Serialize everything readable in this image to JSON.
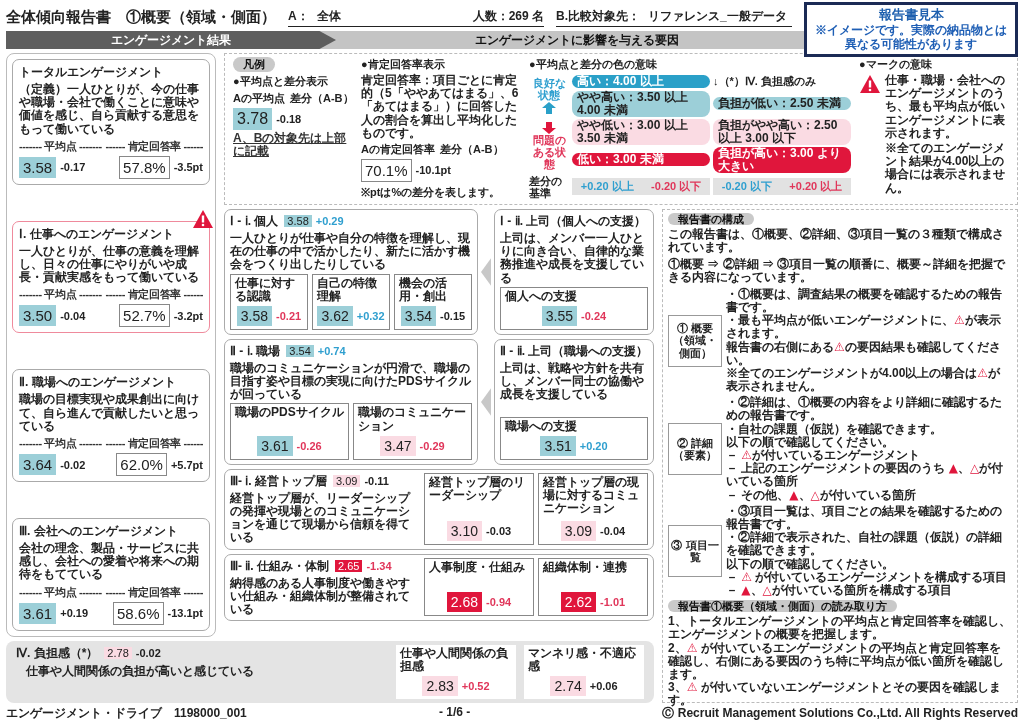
{
  "header": {
    "title": "全体傾向報告書　①概要（領域・側面）",
    "group_a": {
      "label": "A：",
      "value": "全体",
      "count": "人数：269 名"
    },
    "group_b": {
      "label": "B.比較対象先：",
      "value": "リファレンス_一般データ"
    }
  },
  "sample_notice": {
    "title": "報告書見本",
    "text": "※イメージです。実際の納品物とは異なる可能性があります"
  },
  "banner": {
    "results": "エンゲージメント結果",
    "factors": "エンゲージメントに影響を与える要因"
  },
  "total": {
    "title": "トータルエンゲージメント",
    "text": "（定義）一人ひとりが、今の仕事や職場・会社で働くことに意味や価値を感じ、自ら貢献する意思をもって働いている",
    "avg_label": "------- 平均点 -------",
    "rate_label": "------ 肯定回答率 ------",
    "score": {
      "value": "3.58",
      "color": "#9ccfd8",
      "diff": {
        "text": "-0.17",
        "color": "#222222"
      }
    },
    "rate": {
      "value": "57.8%",
      "diff": "-3.5pt"
    }
  },
  "areas": [
    {
      "title": "Ⅰ. 仕事へのエンゲージメント",
      "text": "一人ひとりが、仕事の意義を理解し、日々の仕事にやりがいや成長・貢献実感をもって働いている",
      "warning": true,
      "avg_label": "------- 平均点 -------",
      "rate_label": "------ 肯定回答率 ------",
      "score": {
        "value": "3.50",
        "color": "#9ccfd8",
        "diff": {
          "text": "-0.04",
          "color": "#222222"
        }
      },
      "rate": {
        "value": "52.7%",
        "diff": "-3.2pt"
      }
    },
    {
      "title": "Ⅱ. 職場へのエンゲージメント",
      "text": "職場の目標実現や成果創出に向けて、自ら進んで貢献したいと思っている",
      "warning": false,
      "avg_label": "------- 平均点 -------",
      "rate_label": "------ 肯定回答率 ------",
      "score": {
        "value": "3.64",
        "color": "#9ccfd8",
        "diff": {
          "text": "-0.02",
          "color": "#222222"
        }
      },
      "rate": {
        "value": "62.0%",
        "diff": "+5.7pt"
      }
    },
    {
      "title": "Ⅲ. 会社へのエンゲージメント",
      "text": "会社の理念、製品・サービスに共感し、会社への愛着や将来への期待をもてている",
      "warning": false,
      "avg_label": "------- 平均点 -------",
      "rate_label": "------ 肯定回答率 ------",
      "score": {
        "value": "3.61",
        "color": "#9ccfd8",
        "diff": {
          "text": "+0.19",
          "color": "#222222"
        }
      },
      "rate": {
        "value": "58.6%",
        "diff": "-13.1pt"
      }
    }
  ],
  "legend": {
    "title": "凡例",
    "avg": {
      "heading": "●平均点と差分表示",
      "value_label": "Aの平均点",
      "diff_label": "差分（A-B）",
      "score": {
        "value": "3.78",
        "color": "#9ccfd8",
        "diff": {
          "text": "-0.18",
          "color": "#222222"
        }
      },
      "link": "A、Bの対象先は上部に記載"
    },
    "rate": {
      "heading": "●肯定回答率表示",
      "text": "肯定回答率：項目ごとに肯定的（5「ややあてはまる」、6「あてはまる」）に回答した人の割合を算出し平均化したものです。",
      "value_label": "Aの肯定回答率",
      "diff_label": "差分（A-B）",
      "rate": {
        "value": "70.1%",
        "diff": "-10.1pt"
      },
      "note": "※ptは%の差分を表します。"
    },
    "colors": {
      "heading": "●平均点と差分の色の意味",
      "good_label": "良好な状態",
      "bad_label": "問題のある状態",
      "burden_note": "↓（*）Ⅳ. 負担感のみ",
      "base_label": "差分の基準",
      "main_bands": [
        {
          "text": "高い：4.00 以上",
          "color": "#2aa0c8"
        },
        {
          "text": "やや高い：3.50 以上 4.00 未満",
          "color": "#9ccfd8"
        },
        {
          "text": "やや低い：3.00 以上 3.50 未満",
          "color": "#fadbe3"
        },
        {
          "text": "低い：3.00 未満",
          "color": "#e0163c"
        }
      ],
      "burden_bands": [
        {
          "text": "負担が低い：2.50 未満",
          "color": "#9ccfd8"
        },
        {
          "text": "負担がやや高い：2.50 以上 3.00 以下",
          "color": "#fadbe3"
        },
        {
          "text": "負担が高い：3.00 より大きい",
          "color": "#e0163c"
        }
      ],
      "main_base": [
        {
          "text": "+0.20 以上",
          "color": "#2f9fcf"
        },
        {
          "text": "-0.20 以下",
          "color": "#e0365a"
        }
      ],
      "burden_base": [
        {
          "text": "-0.20 以下",
          "color": "#2f9fcf"
        },
        {
          "text": "+0.20 以上",
          "color": "#e0365a"
        }
      ]
    },
    "marks": {
      "heading": "●マークの意味",
      "text": "仕事・職場・会社へのエンゲージメントのうち、最も平均点が低いエンゲージメントに表示されます。",
      "note": "※全てのエンゲージメント結果が4.00以上の場合には表示されません。"
    }
  },
  "factors": [
    {
      "kind": "split",
      "main": {
        "title": "Ⅰ - ⅰ. 個人",
        "score": {
          "value": "3.58",
          "color": "#9ccfd8",
          "diff": {
            "text": "+0.29",
            "color": "#2f9fcf"
          }
        },
        "text": "一人ひとりが仕事や自分の特徴を理解し、現在の仕事の中で活かしたり、新たに活かす機会をつくり出したりしている",
        "items": [
          {
            "label": "仕事に対する認識",
            "score": {
              "value": "3.58",
              "color": "#9ccfd8",
              "diff": {
                "text": "-0.21",
                "color": "#e0365a"
              }
            }
          },
          {
            "label": "自己の特徴理解",
            "score": {
              "value": "3.62",
              "color": "#9ccfd8",
              "diff": {
                "text": "+0.32",
                "color": "#2f9fcf"
              }
            }
          },
          {
            "label": "機会の活用・創出",
            "score": {
              "value": "3.54",
              "color": "#9ccfd8",
              "diff": {
                "text": "-0.15",
                "color": "#222222"
              }
            }
          }
        ]
      },
      "side": {
        "title": "Ⅰ - ⅱ. 上司（個人への支援）",
        "text": "上司は、メンバー一人ひとりに向き合い、自律的な業務推進や成長を支援している",
        "items": [
          {
            "label": "個人への支援",
            "score": {
              "value": "3.55",
              "color": "#9ccfd8",
              "diff": {
                "text": "-0.24",
                "color": "#e0365a"
              }
            }
          }
        ]
      }
    },
    {
      "kind": "split",
      "main": {
        "title": "Ⅱ - ⅰ. 職場",
        "score": {
          "value": "3.54",
          "color": "#9ccfd8",
          "diff": {
            "text": "+0.74",
            "color": "#2f9fcf"
          }
        },
        "text": "職場のコミュニケーションが円滑で、職場の目指す姿や目標の実現に向けたPDSサイクルが回っている",
        "items": [
          {
            "label": "職場のPDSサイクル",
            "score": {
              "value": "3.61",
              "color": "#9ccfd8",
              "diff": {
                "text": "-0.26",
                "color": "#e0365a"
              }
            }
          },
          {
            "label": "職場のコミュニケーション",
            "score": {
              "value": "3.47",
              "color": "#fadbe3",
              "diff": {
                "text": "-0.29",
                "color": "#e0365a"
              }
            }
          }
        ]
      },
      "side": {
        "title": "Ⅱ - ⅱ. 上司（職場への支援）",
        "text": "上司は、戦略や方針を共有し、メンバー同士の協働や成長を支援している",
        "items": [
          {
            "label": "職場への支援",
            "score": {
              "value": "3.51",
              "color": "#9ccfd8",
              "diff": {
                "text": "+0.20",
                "color": "#2f9fcf"
              }
            }
          }
        ]
      }
    },
    {
      "kind": "row",
      "title": "Ⅲ- ⅰ. 経営トップ層",
      "score": {
        "value": "3.09",
        "color": "#fadbe3",
        "diff": {
          "text": "-0.11",
          "color": "#222222"
        }
      },
      "text": "経営トップ層が、リーダーシップの発揮や現場とのコミュニケーションを通じて現場から信頼を得ている",
      "items": [
        {
          "label": "経営トップ層のリーダーシップ",
          "score": {
            "value": "3.10",
            "color": "#fadbe3",
            "diff": {
              "text": "-0.03",
              "color": "#222222"
            }
          }
        },
        {
          "label": "経営トップ層の現場に対するコミュニケーション",
          "score": {
            "value": "3.09",
            "color": "#fadbe3",
            "diff": {
              "text": "-0.04",
              "color": "#222222"
            }
          }
        }
      ]
    },
    {
      "kind": "row",
      "title": "Ⅲ- ⅱ. 仕組み・体制",
      "score": {
        "value": "2.65",
        "color": "#e0163c",
        "diff": {
          "text": "-1.34",
          "color": "#e0365a"
        }
      },
      "text": "納得感のある人事制度や働きやすい仕組み・組織体制が整備されている",
      "items": [
        {
          "label": "人事制度・仕組み",
          "score": {
            "value": "2.68",
            "color": "#e0163c",
            "diff": {
              "text": "-0.94",
              "color": "#e0365a"
            }
          }
        },
        {
          "label": "組織体制・連携",
          "score": {
            "value": "2.62",
            "color": "#e0163c",
            "diff": {
              "text": "-1.01",
              "color": "#e0365a"
            }
          }
        }
      ]
    }
  ],
  "burden": {
    "title": "Ⅳ. 負担感（*）",
    "score": {
      "value": "2.78",
      "color": "#fadbe3",
      "diff": {
        "text": "-0.02",
        "color": "#222222"
      }
    },
    "text": "仕事や人間関係の負担が高いと感じている",
    "items": [
      {
        "label": "仕事や人間関係の負担感",
        "score": {
          "value": "2.83",
          "color": "#fadbe3",
          "diff": {
            "text": "+0.52",
            "color": "#e0365a"
          }
        }
      },
      {
        "label": "マンネリ感・不適応感",
        "score": {
          "value": "2.74",
          "color": "#fadbe3",
          "diff": {
            "text": "+0.06",
            "color": "#222222"
          }
        }
      }
    ]
  },
  "guide": {
    "heading": "報告書の構成",
    "intro": [
      "この報告書は、①概要、②詳細、③項目一覧の３種類で構成されています。",
      "①概要 ⇒ ②詳細 ⇒ ③項目一覧の順番に、概要～詳細を把握できる内容になっています。"
    ],
    "reports": [
      {
        "label": [
          "① 概要",
          "（領域・側面）"
        ],
        "lines": [
          "・①概要は、調査結果の概要を確認するための報告書です。",
          "・最も平均点が低いエンゲージメントに、**⚠**が表示されます。",
          "報告書の右側にある**⚠**の要因結果も確認してください。",
          "※全てのエンゲージメントが4.00以上の場合は**⚠**が表示されません。"
        ]
      },
      {
        "label": [
          "② 詳細",
          "（要素）"
        ],
        "lines": [
          "・②詳細は、①概要の内容をより詳細に確認するための報告書です。",
          "・自社の課題（仮説）を確認できます。",
          "以下の順で確認してください。",
          "－ **⚠**が付いているエンゲージメント",
          "－ 上記のエンゲージメントの要因のうち **▲**、**△**が付いている箇所",
          "－ その他、**▲**、**△**が付いている箇所"
        ]
      },
      {
        "label": [
          "③ 項目一覧"
        ],
        "lines": [
          "・③項目一覧は、項目ごとの結果を確認するための報告書です。",
          "・②詳細で表示された、自社の課題（仮説）の詳細を確認できます。",
          "以下の順で確認してください。",
          "－ **⚠** が付いているエンゲージメントを構成する項目",
          "－ **▲**、**△**が付いている箇所を構成する項目"
        ]
      }
    ],
    "reading_heading": "報告書①概要（領域・側面）の読み取り方",
    "steps": [
      "1、トータルエンゲージメントの平均点と肯定回答率を確認し、エンゲージメントの概要を把握します。",
      "2、**⚠** が付いているエンゲージメントの平均点と肯定回答率を確認し、右側にある要因のうち特に平均点が低い箇所を確認します。",
      "3、**⚠** が付いていないエンゲージメントとその要因を確認します。"
    ]
  },
  "footer": {
    "left": "エンゲージメント・ドライブ　1198000_001",
    "center": "- 1/6 -",
    "right": "Ⓒ Recruit Management Solutions Co.,Ltd. All Rights Reserved"
  }
}
